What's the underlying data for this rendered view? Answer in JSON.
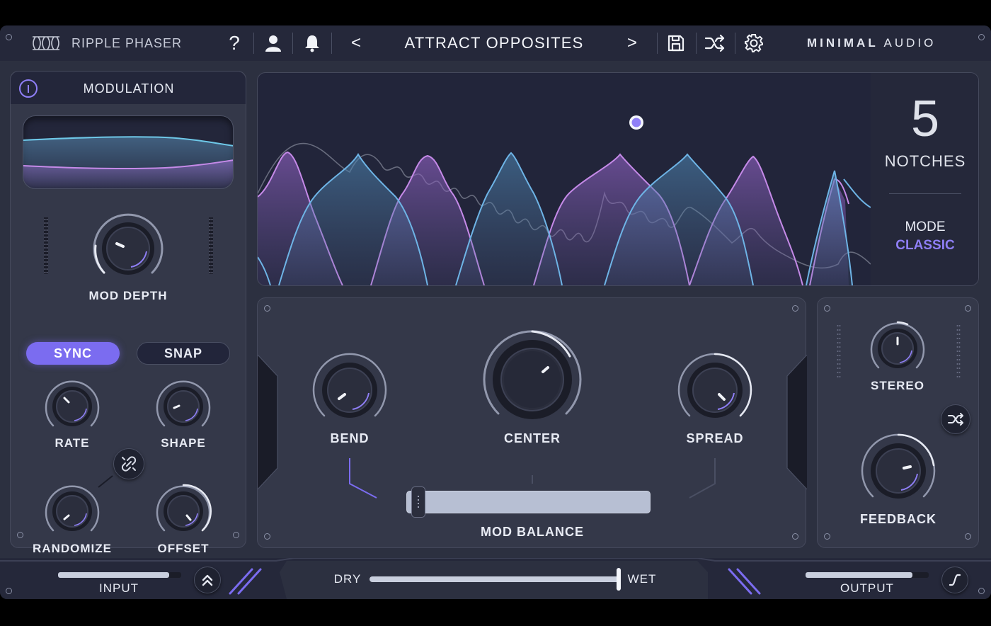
{
  "header": {
    "plugin_name": "RIPPLE PHASER",
    "help_label": "?",
    "preset_name": "ATTRACT OPPOSITES",
    "prev_label": "<",
    "next_label": ">",
    "brand_left": "MINIMAL",
    "brand_right": "AUDIO"
  },
  "modulation": {
    "title": "MODULATION",
    "mod_depth_label": "MOD DEPTH",
    "sync_label": "SYNC",
    "snap_label": "SNAP",
    "rate_label": "RATE",
    "shape_label": "SHAPE",
    "randomize_label": "RANDOMIZE",
    "offset_label": "OFFSET",
    "sync_active": true,
    "snap_active": false
  },
  "display": {
    "notches_value": "5",
    "notches_label": "NOTCHES",
    "mode_label": "MODE",
    "mode_value": "CLASSIC"
  },
  "main": {
    "bend_label": "BEND",
    "center_label": "CENTER",
    "spread_label": "SPREAD",
    "mod_balance_label": "MOD BALANCE",
    "mod_balance_value": 0.02
  },
  "side": {
    "stereo_label": "STEREO",
    "feedback_label": "FEEDBACK"
  },
  "bottom": {
    "input_label": "INPUT",
    "output_label": "OUTPUT",
    "dry_label": "DRY",
    "wet_label": "WET",
    "mix_value": 1.0,
    "input_level": 0.9,
    "output_level": 0.87
  },
  "colors": {
    "accent": "#7b6cf0",
    "accent_text": "#8f7ff7",
    "blue_curve": "#6eb4e6",
    "pink_curve": "#c58ae8"
  }
}
